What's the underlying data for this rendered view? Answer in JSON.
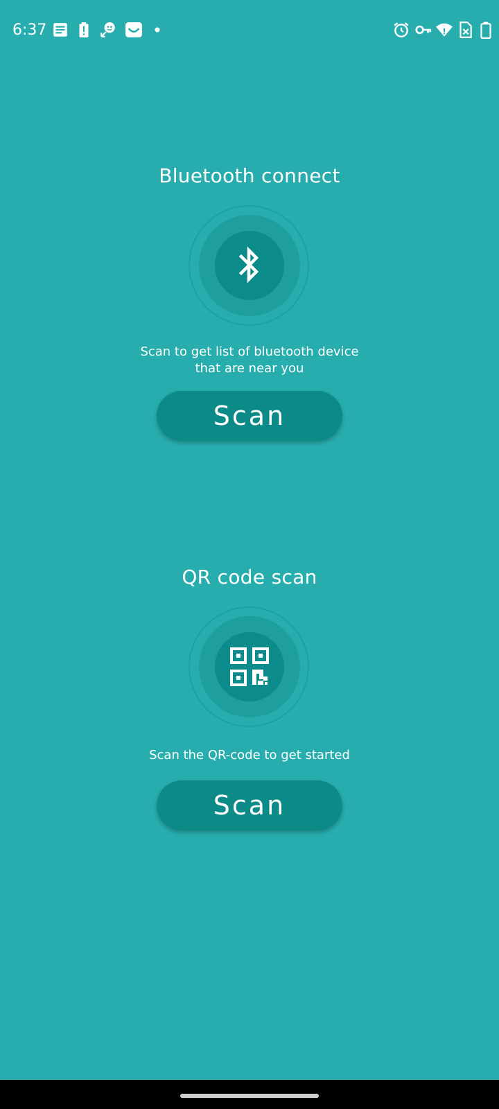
{
  "status_bar": {
    "time": "6:37",
    "left_icons": [
      "notes-icon",
      "battery-alert-icon",
      "face-assist-icon",
      "smile-app-icon",
      "notification-dot-icon"
    ],
    "right_icons": [
      "alarm-icon",
      "vpn-key-icon",
      "wifi-icon",
      "sim-error-icon",
      "battery-icon"
    ]
  },
  "bluetooth": {
    "title": "Bluetooth connect",
    "description_line1": "Scan to get list of bluetooth device",
    "description_line2": "that are near you",
    "button_label": "Scan",
    "icon": "bluetooth-icon"
  },
  "qr": {
    "title": "QR code scan",
    "description": "Scan the QR-code to get started",
    "button_label": "Scan",
    "icon": "qr-code-icon"
  },
  "colors": {
    "background": "#27adad",
    "button": "#0b8a88",
    "circle_inner": "#0b8b89",
    "circle_mid": "#1e9e9c",
    "text": "#ffffff",
    "nav_bar": "#000000"
  }
}
